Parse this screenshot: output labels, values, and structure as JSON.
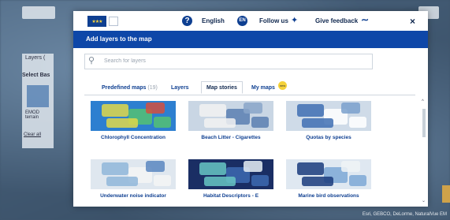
{
  "background": {
    "layers_tab_label": "Layers (",
    "select_base_label": "Select Bas",
    "base_item_label_1": "EMOD",
    "base_item_label_2": "terrain",
    "clear_all_label": "Clear all",
    "credits": "Esri, GEBCO, DeLorme, NaturalVue   EM"
  },
  "topbar": {
    "language": "English",
    "language_code": "EN",
    "follow_label": "Follow us",
    "feedback_label": "Give feedback",
    "close_label": "×"
  },
  "modal": {
    "title": "Add layers to the map",
    "search": {
      "placeholder": "Search for layers",
      "value": ""
    }
  },
  "tabs": [
    {
      "label": "Predefined maps",
      "count": "(19)"
    },
    {
      "label": "Layers"
    },
    {
      "label": "Map stories",
      "active": true
    },
    {
      "label": "My maps",
      "badge": "new"
    }
  ],
  "cards": [
    {
      "title": "Chlorophyll Concentration",
      "colors": [
        "#2d7fd0",
        "#e0d84a",
        "#55c173",
        "#d34f3f"
      ]
    },
    {
      "title": "Beach Litter - Cigarettes",
      "colors": [
        "#c9d6e4",
        "#f2f2f2",
        "#5a7fb2",
        "#8aa6c9"
      ]
    },
    {
      "title": "Quotas by species",
      "colors": [
        "#cfdbe8",
        "#3f6fb3",
        "#ffffff",
        "#7aa0cd"
      ]
    },
    {
      "title": "Underwater noise indicator",
      "colors": [
        "#dfe7ef",
        "#90b6d9",
        "#f4f4f4",
        "#5a86bf"
      ]
    },
    {
      "title": "Habitat Descriptors - E",
      "colors": [
        "#1a2e64",
        "#67c5c3",
        "#3d68b0",
        "#e8eef5"
      ]
    },
    {
      "title": "Marine bird observations",
      "colors": [
        "#dfe8f1",
        "#1a3b7c",
        "#7ea8d6",
        "#f0f3f6"
      ]
    }
  ],
  "colors": {
    "brand_blue": "#0e47a8",
    "dark_text": "#10284f",
    "link_blue": "#0e3f91"
  }
}
